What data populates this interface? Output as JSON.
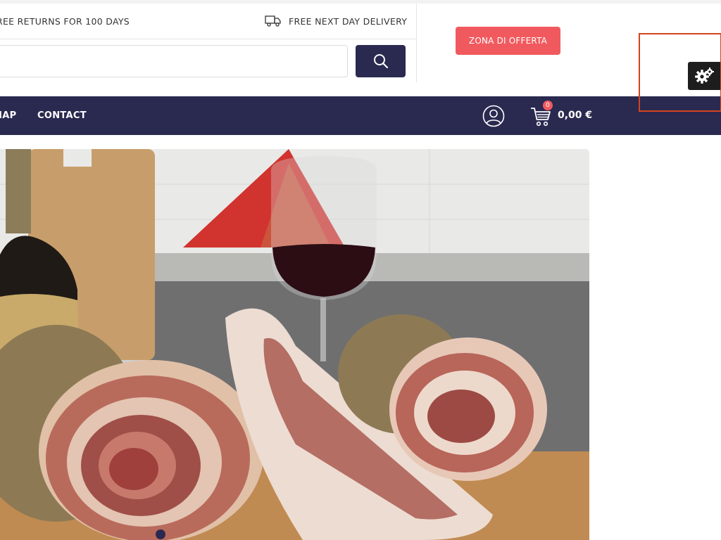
{
  "topbar": {
    "returns_text": "REE RETURNS FOR 100 DAYS",
    "delivery_text": "FREE NEXT DAY DELIVERY",
    "delivery_icon": "truck-icon"
  },
  "search": {
    "placeholder": "",
    "button_icon": "search-icon"
  },
  "offer_button": {
    "label": "ZONA DI OFFERTA",
    "color": "#f05a5e"
  },
  "nav": {
    "items": [
      {
        "label": "MAP"
      },
      {
        "label": "CONTACT"
      }
    ],
    "account_icon": "user-icon",
    "cart": {
      "icon": "cart-icon",
      "count": "0",
      "total": "0,00 €"
    },
    "background": "#2a2950"
  },
  "hero": {
    "image": "porchetta-and-red-wine-photo",
    "active_slide": 1
  },
  "settings": {
    "icon": "gears-icon"
  },
  "colors": {
    "accent": "#f05a5e",
    "navy": "#2a2950",
    "highlight": "#d3441c"
  }
}
